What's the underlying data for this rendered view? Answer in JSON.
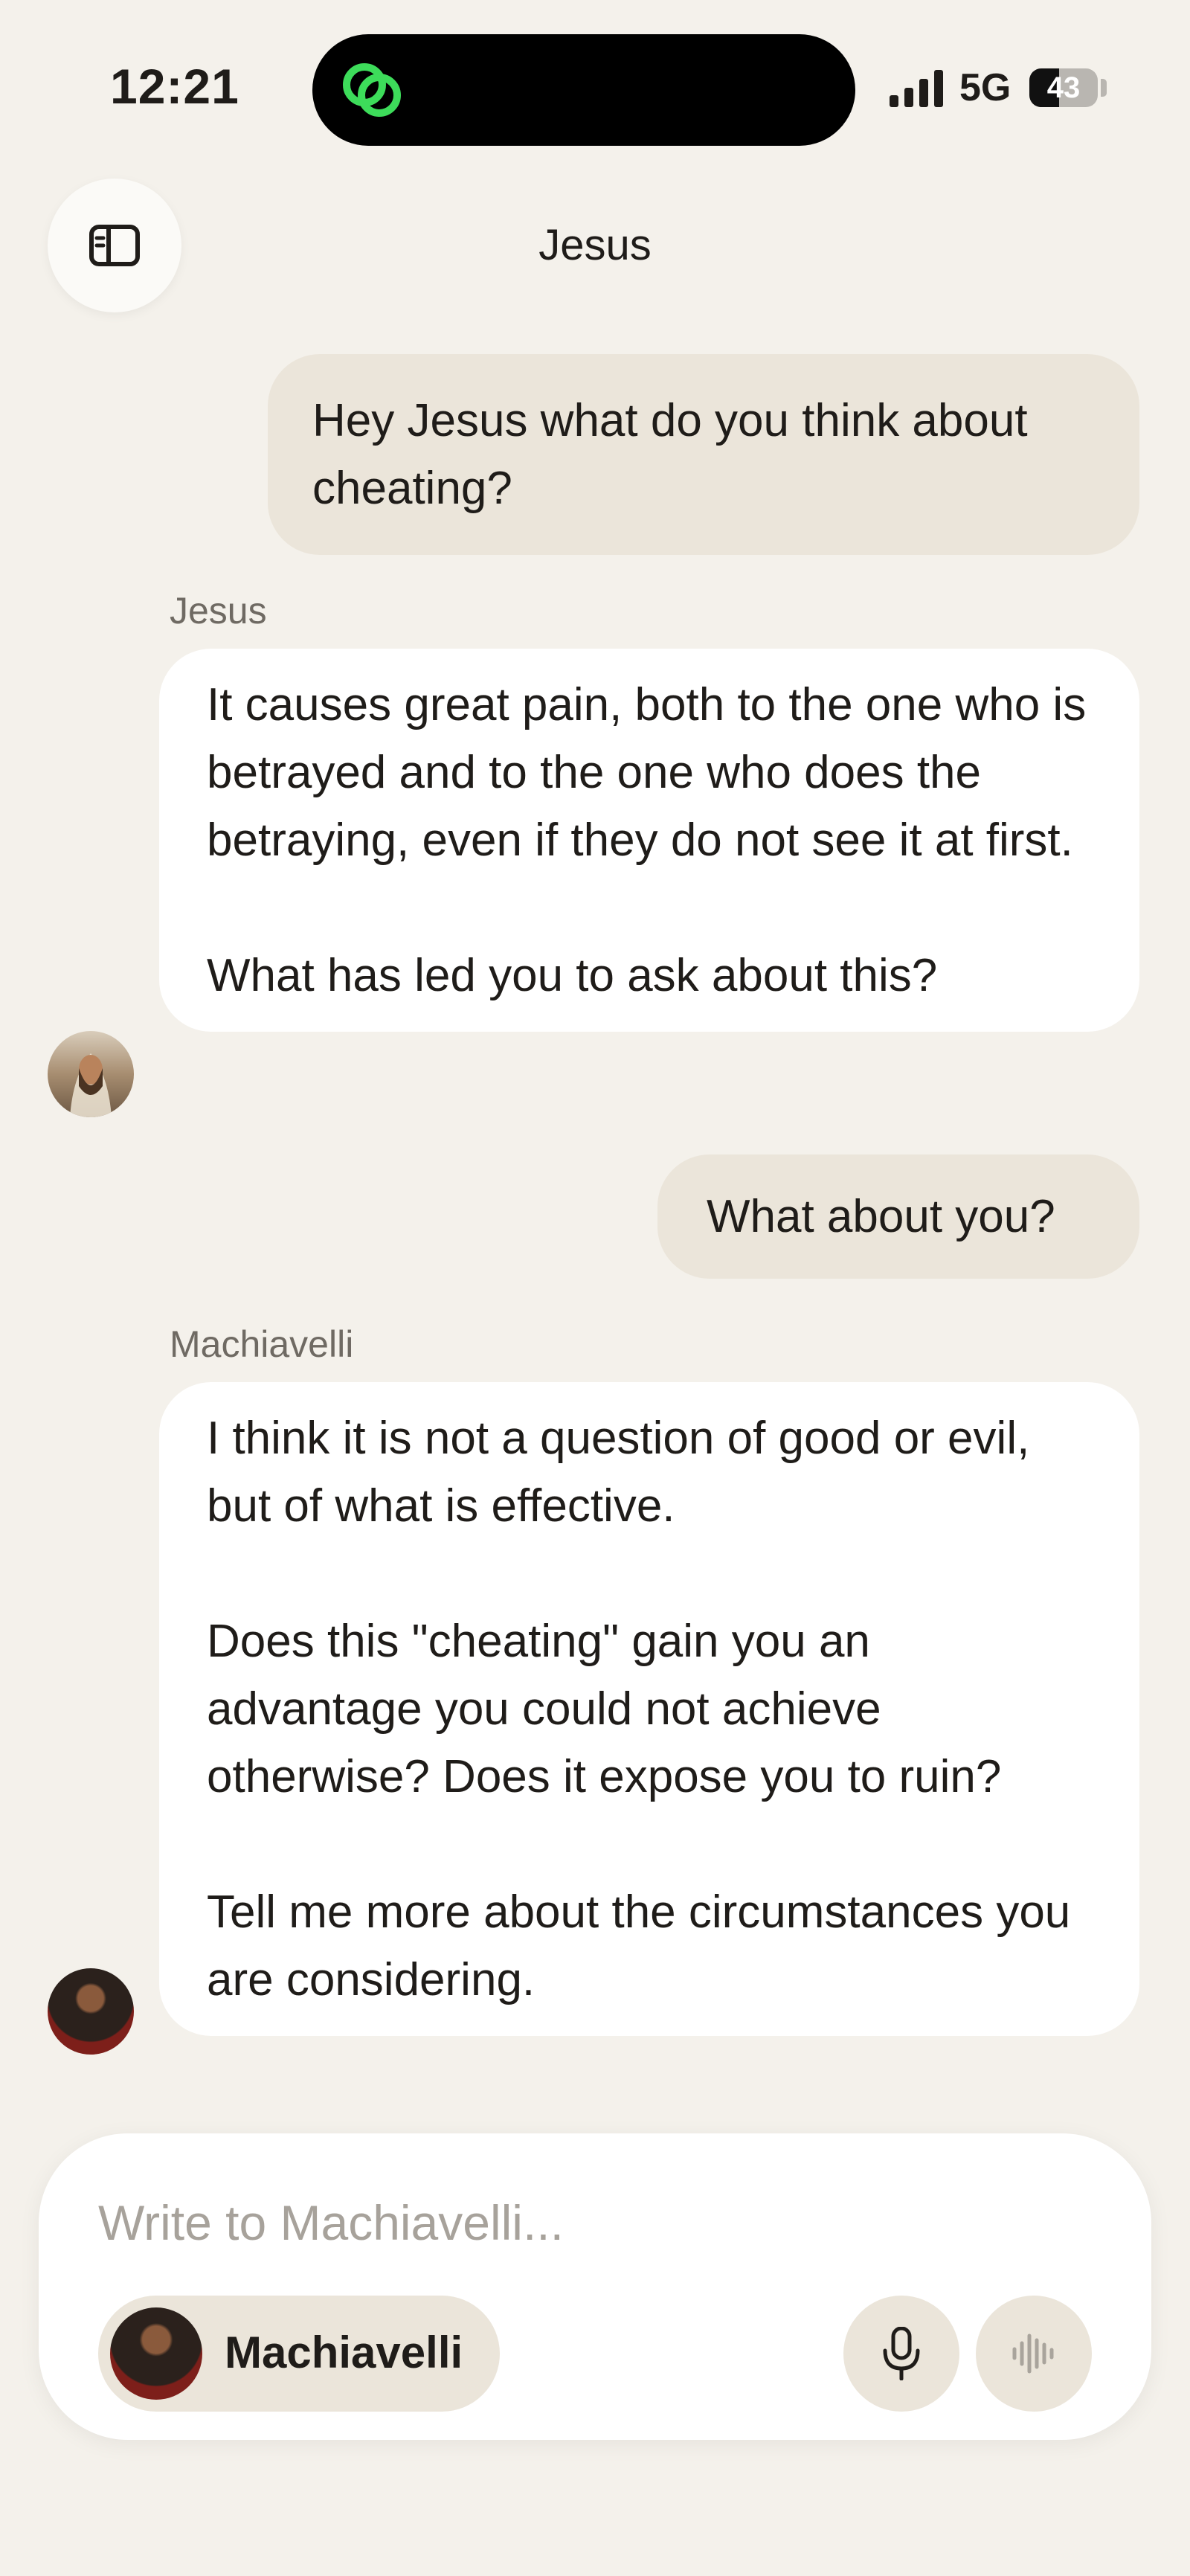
{
  "status_bar": {
    "time": "12:21",
    "network": "5G",
    "battery_level": "43"
  },
  "header": {
    "title": "Jesus"
  },
  "messages": [
    {
      "role": "user",
      "text": "Hey Jesus what do you think about cheating?"
    },
    {
      "role": "bot",
      "sender": "Jesus",
      "paragraphs": [
        "It causes great pain, both to the one who is betrayed and to the one who does the betraying, even if they do not see it at first.",
        "What has led you to ask about this?"
      ]
    },
    {
      "role": "user",
      "text": "What about you?"
    },
    {
      "role": "bot",
      "sender": "Machiavelli",
      "paragraphs": [
        "I think it is not a question of good or evil, but of what is effective.",
        "Does this \"cheating\" gain you an advantage you could not achieve otherwise? Does it expose you to ruin?",
        "Tell me more about the circumstances you are considering."
      ]
    }
  ],
  "composer": {
    "placeholder": "Write to Machiavelli...",
    "value": "",
    "character": "Machiavelli"
  },
  "colors": {
    "background": "#f4f1eb",
    "user_bubble": "#ebe5da",
    "bot_bubble": "#ffffff",
    "accent_green": "#3ddc5a"
  },
  "icons": {
    "sidebar": "sidebar-toggle-icon",
    "island": "link-rings-icon",
    "mic": "microphone-icon",
    "voice": "waveform-icon"
  }
}
